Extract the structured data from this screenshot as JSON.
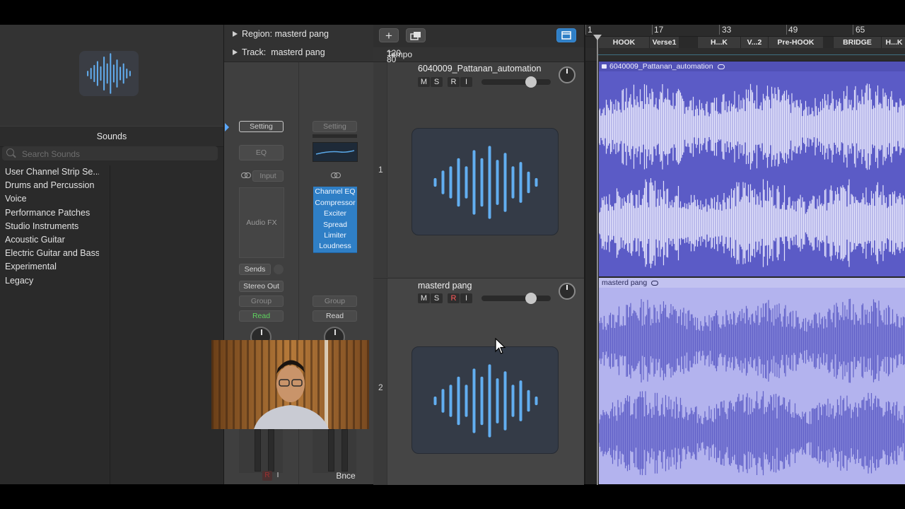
{
  "library": {
    "header": "Sounds",
    "search_placeholder": "Search Sounds",
    "items": [
      {
        "label": "User Channel Strip Se..."
      },
      {
        "label": "Drums and Percussion"
      },
      {
        "label": "Voice"
      },
      {
        "label": "Performance Patches"
      },
      {
        "label": "Studio Instruments"
      },
      {
        "label": "Acoustic Guitar"
      },
      {
        "label": "Electric Guitar and Bass"
      },
      {
        "label": "Experimental"
      },
      {
        "label": "Legacy"
      }
    ]
  },
  "inspector": {
    "region_label": "Region:",
    "region_name": "masterd pang",
    "track_label": "Track:",
    "track_name": "masterd pang",
    "left_strip": {
      "setting": "Setting",
      "eq": "EQ",
      "input": "Input",
      "audio_fx": "Audio FX",
      "sends": "Sends",
      "output": "Stereo Out",
      "group": "Group",
      "automation": "Read"
    },
    "right_strip": {
      "setting": "Setting",
      "plugins": [
        "Channel EQ",
        "Compressor",
        "Exciter",
        "Spread",
        "Limiter",
        "Loudness"
      ],
      "group": "Group",
      "automation": "Read",
      "bounce": "Bnce"
    }
  },
  "tracks_area": {
    "add_button": "+",
    "tempo_label": "Tempo",
    "tempo_values": [
      "120",
      "80"
    ],
    "tracks": [
      {
        "number": "1",
        "name": "6040009_Pattanan_automation",
        "buttons": [
          "M",
          "S",
          "R",
          "I"
        ]
      },
      {
        "number": "2",
        "name": "masterd pang",
        "buttons": [
          "M",
          "S",
          "R",
          "I"
        ]
      }
    ]
  },
  "arrange": {
    "bar_numbers": [
      "1",
      "17",
      "33",
      "49",
      "65"
    ],
    "markers": [
      "HOOK",
      "Verse1",
      "H...K",
      "V...2",
      "Pre-HOOK",
      "BRIDGE",
      "H...K"
    ],
    "regions": [
      {
        "name": "6040009_Pattanan_automation",
        "color": "#5b5bc6"
      },
      {
        "name": "masterd pang",
        "color": "#b3b3ee"
      }
    ]
  },
  "colors": {
    "accent_blue": "#2f7fc6",
    "waveform_icon": "#62aef0",
    "read_green": "#5fd35f",
    "record_red": "#ff5a5a"
  }
}
